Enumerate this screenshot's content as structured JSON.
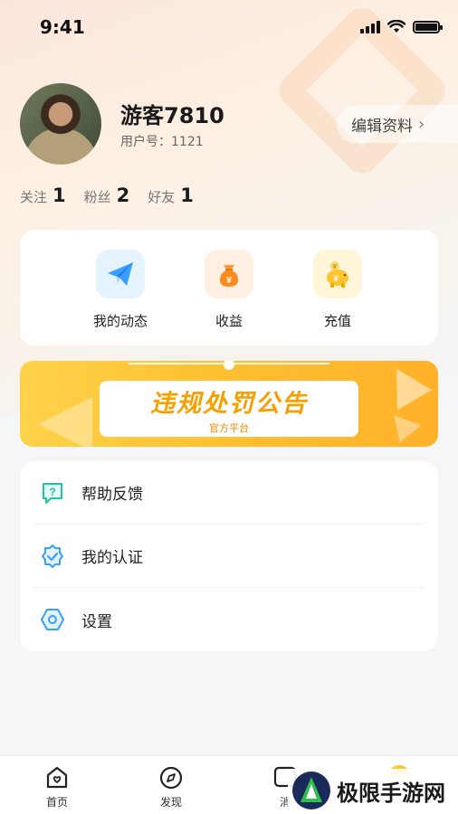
{
  "status_bar": {
    "time": "9:41"
  },
  "profile": {
    "username": "游客7810",
    "user_id": "用户号：1121",
    "edit_label": "编辑资料"
  },
  "stats": [
    {
      "label": "关注",
      "value": "1"
    },
    {
      "label": "粉丝",
      "value": "2"
    },
    {
      "label": "好友",
      "value": "1"
    }
  ],
  "quick_actions": [
    {
      "label": "我的动态",
      "icon": "paper-plane-icon"
    },
    {
      "label": "收益",
      "icon": "money-bag-icon"
    },
    {
      "label": "充值",
      "icon": "piggy-bank-icon"
    }
  ],
  "banner": {
    "title": "违规处罚公告",
    "subtitle": "官方平台"
  },
  "menu": [
    {
      "label": "帮助反馈",
      "icon": "help-chat-icon"
    },
    {
      "label": "我的认证",
      "icon": "verified-badge-icon"
    },
    {
      "label": "设置",
      "icon": "settings-hexagon-icon"
    }
  ],
  "tabbar": [
    {
      "label": "首页",
      "icon": "home-icon"
    },
    {
      "label": "发现",
      "icon": "compass-icon"
    },
    {
      "label": "消",
      "icon": "message-icon"
    },
    {
      "label": "",
      "icon": "profile-icon"
    }
  ],
  "watermark": {
    "text": "极限手游网"
  },
  "colors": {
    "accent_yellow": "#ffc531",
    "banner_text": "#f5a000",
    "teal": "#22c3a0",
    "blue": "#3aa0ff"
  }
}
